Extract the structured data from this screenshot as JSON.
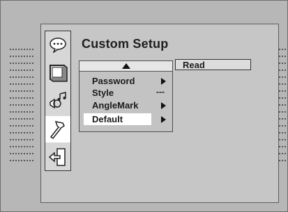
{
  "screen": {
    "title": "Custom Setup"
  },
  "side_icons": [
    {
      "name": "language-icon",
      "glyph": "ʘ"
    },
    {
      "name": "tv-screen-icon",
      "glyph": "▭"
    },
    {
      "name": "audio-icon",
      "glyph": "♫"
    },
    {
      "name": "custom-setup-icon",
      "glyph": "🔨",
      "selected": true
    },
    {
      "name": "exit-icon",
      "glyph": "⇦"
    }
  ],
  "menu": {
    "items": [
      {
        "label": "Password",
        "indicator": "arrow"
      },
      {
        "label": "Style",
        "indicator": "---"
      },
      {
        "label": "AngleMark",
        "indicator": "arrow"
      },
      {
        "label": "Default",
        "indicator": "arrow",
        "selected": true
      }
    ]
  },
  "submenu": {
    "value": "Read"
  }
}
